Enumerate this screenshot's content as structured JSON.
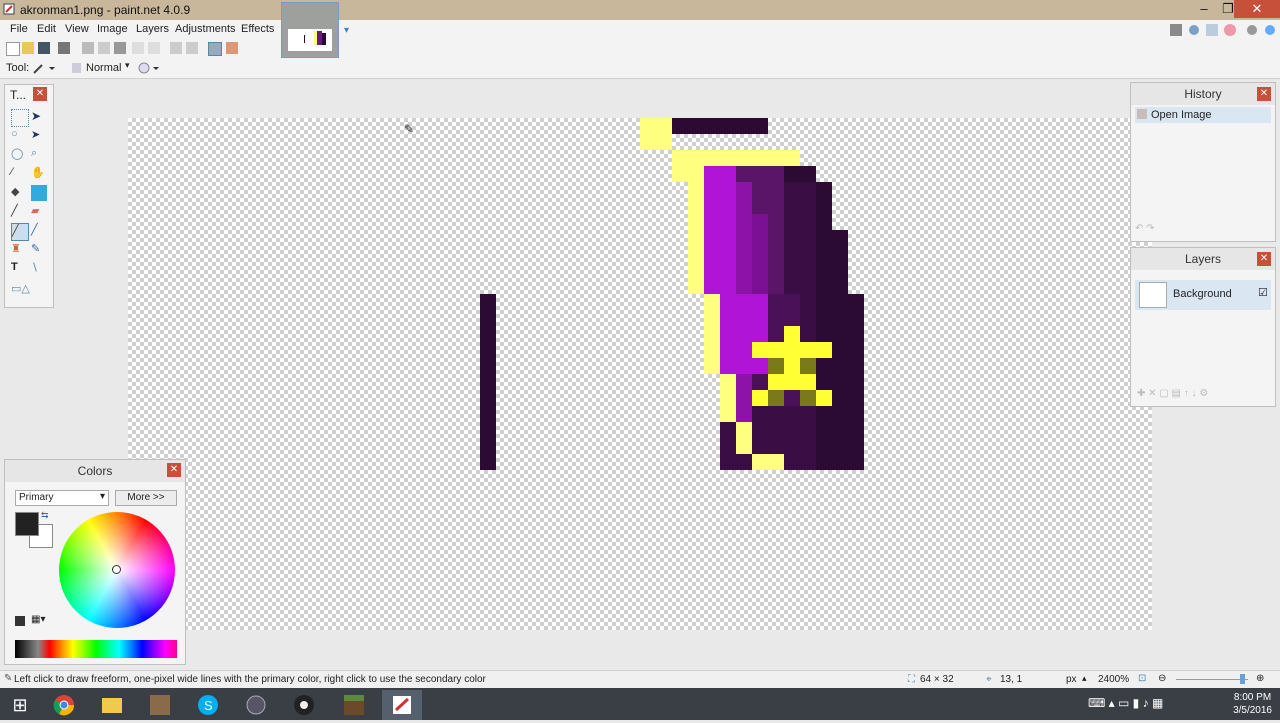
{
  "window": {
    "title": "akronman1.png - paint.net 4.0.9",
    "minimize": "–",
    "maximize": "❐",
    "close": "✕"
  },
  "menu": {
    "items": [
      "File",
      "Edit",
      "View",
      "Image",
      "Layers",
      "Adjustments",
      "Effects"
    ]
  },
  "tool_options": {
    "tool_label": "Tool:",
    "blend_mode": "Normal"
  },
  "tools_panel": {
    "title": "T...",
    "close": "✕"
  },
  "history": {
    "title": "History",
    "close": "✕",
    "items": [
      "Open Image"
    ]
  },
  "layers": {
    "title": "Layers",
    "close": "✕",
    "items": [
      {
        "name": "Background",
        "visible": true
      }
    ]
  },
  "colors": {
    "title": "Colors",
    "close": "✕",
    "mode": "Primary",
    "more_button": "More >>"
  },
  "status": {
    "hint": "Left click to draw freeform, one-pixel wide lines with the primary color, right click to use the secondary color",
    "image_size": "64 × 32",
    "cursor_pos": "13, 1",
    "units": "px",
    "zoom": "2400%"
  },
  "taskbar": {
    "time": "8:00 PM",
    "date": "3/5/2016"
  },
  "theme": {
    "accent": "#c9b79c",
    "close_red": "#c7503b",
    "yellow": "#ffff7f",
    "dark": "#2b0a33",
    "purple": "#b014d6"
  }
}
